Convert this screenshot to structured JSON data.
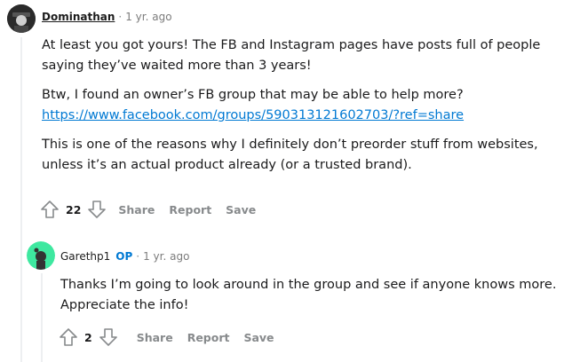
{
  "comments": [
    {
      "author": "Dominathan",
      "time": "1 yr. ago",
      "paragraphs": [
        "At least you got yours! The FB and Instagram pages have posts full of people saying they’ve waited more than 3 years!",
        "Btw, I found an owner’s FB group that may be able to help more?",
        "This is one of the reasons why I definitely don’t preorder stuff from websites, unless it’s an actual product already (or a trusted brand)."
      ],
      "link": "https://www.facebook.com/groups/590313121602703/?ref=share",
      "score": "22",
      "actions": {
        "share": "Share",
        "report": "Report",
        "save": "Save"
      }
    },
    {
      "author": "Garethp1",
      "op_badge": "OP",
      "time": "1 yr. ago",
      "paragraphs": [
        "Thanks I’m going to look around in the group and see if anyone knows more. Appreciate the info!"
      ],
      "score": "2",
      "actions": {
        "share": "Share",
        "report": "Report",
        "save": "Save"
      }
    }
  ],
  "separator": "·",
  "icons": [
    "upvote-icon",
    "downvote-icon"
  ],
  "colors": {
    "link": "#0079d3",
    "op_badge": "#0079d3",
    "avatar2_bg": "#3ee8a0"
  }
}
